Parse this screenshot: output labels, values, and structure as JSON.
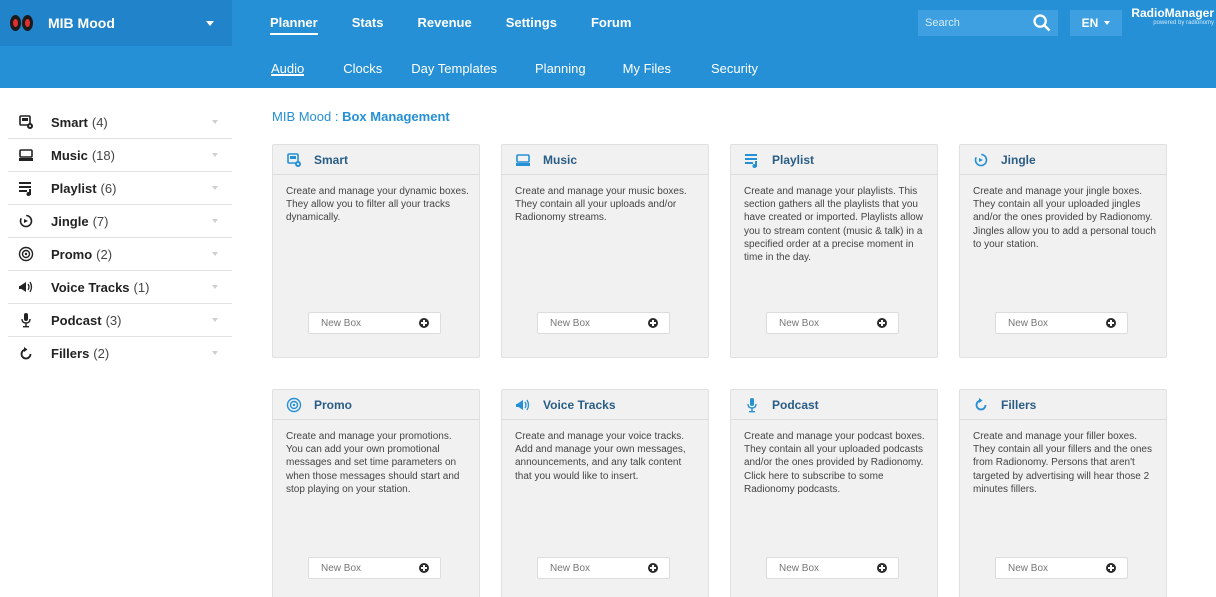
{
  "station": {
    "name": "MIB Mood"
  },
  "main_nav": [
    {
      "label": "Planner",
      "active": true
    },
    {
      "label": "Stats"
    },
    {
      "label": "Revenue"
    },
    {
      "label": "Settings"
    },
    {
      "label": "Forum"
    }
  ],
  "search": {
    "placeholder": "Search"
  },
  "language": "EN",
  "brand": {
    "name": "RadioManager",
    "tagline": "powered by radionomy"
  },
  "sub_nav": [
    {
      "label": "Audio",
      "active": true
    },
    {
      "label": "Clocks"
    },
    {
      "label": "Day Templates"
    },
    {
      "label": "Planning"
    },
    {
      "label": "My Files"
    },
    {
      "label": "Security"
    }
  ],
  "sidebar": {
    "items": [
      {
        "label": "Smart",
        "count": "(4)",
        "icon": "smart-icon"
      },
      {
        "label": "Music",
        "count": "(18)",
        "icon": "music-icon"
      },
      {
        "label": "Playlist",
        "count": "(6)",
        "icon": "playlist-icon"
      },
      {
        "label": "Jingle",
        "count": "(7)",
        "icon": "jingle-icon"
      },
      {
        "label": "Promo",
        "count": "(2)",
        "icon": "promo-icon"
      },
      {
        "label": "Voice Tracks",
        "count": "(1)",
        "icon": "voice-tracks-icon"
      },
      {
        "label": "Podcast",
        "count": "(3)",
        "icon": "podcast-icon"
      },
      {
        "label": "Fillers",
        "count": "(2)",
        "icon": "fillers-icon"
      }
    ]
  },
  "breadcrumb": {
    "station": "MIB Mood",
    "separator": " : ",
    "page": "Box Management"
  },
  "cards": [
    {
      "title": "Smart",
      "icon": "smart-icon",
      "description": "Create and manage your dynamic boxes. They allow you to filter all your tracks dynamically.",
      "button": "New Box"
    },
    {
      "title": "Music",
      "icon": "music-icon",
      "description": "Create and manage your music boxes. They contain all your uploads and/or Radionomy streams.",
      "button": "New Box"
    },
    {
      "title": "Playlist",
      "icon": "playlist-icon",
      "description": "Create and manage your playlists. This section gathers all the playlists that you have created or imported. Playlists allow you to stream content (music & talk) in a specified order at a precise moment in time in the day.",
      "button": "New Box"
    },
    {
      "title": "Jingle",
      "icon": "jingle-icon",
      "description": "Create and manage your jingle boxes. They contain all your uploaded jingles and/or the ones provided by Radionomy. Jingles allow you to add a personal touch to your station.",
      "button": "New Box"
    },
    {
      "title": "Promo",
      "icon": "promo-icon",
      "description": "Create and manage your promotions. You can add your own promotional messages and set time parameters on when those messages should start and stop playing on your station.",
      "button": "New Box"
    },
    {
      "title": "Voice Tracks",
      "icon": "voice-tracks-icon",
      "description": "Create and manage your voice tracks. Add and manage your own messages, announcements, and any talk content that you would like to insert.",
      "button": "New Box"
    },
    {
      "title": "Podcast",
      "icon": "podcast-icon",
      "description": "Create and manage your podcast boxes. They contain all your uploaded podcasts and/or the ones provided by Radionomy. Click here to subscribe to some Radionomy podcasts.",
      "button": "New Box"
    },
    {
      "title": "Fillers",
      "icon": "fillers-icon",
      "description": "Create and manage your filler boxes. They contain all your fillers and the ones from Radionomy. Persons that aren't targeted by advertising will hear those 2 minutes fillers.",
      "button": "New Box"
    }
  ],
  "colors": {
    "primary": "#2590d6",
    "title_text": "#2a5d86",
    "card_bg": "#f1f1f1"
  }
}
